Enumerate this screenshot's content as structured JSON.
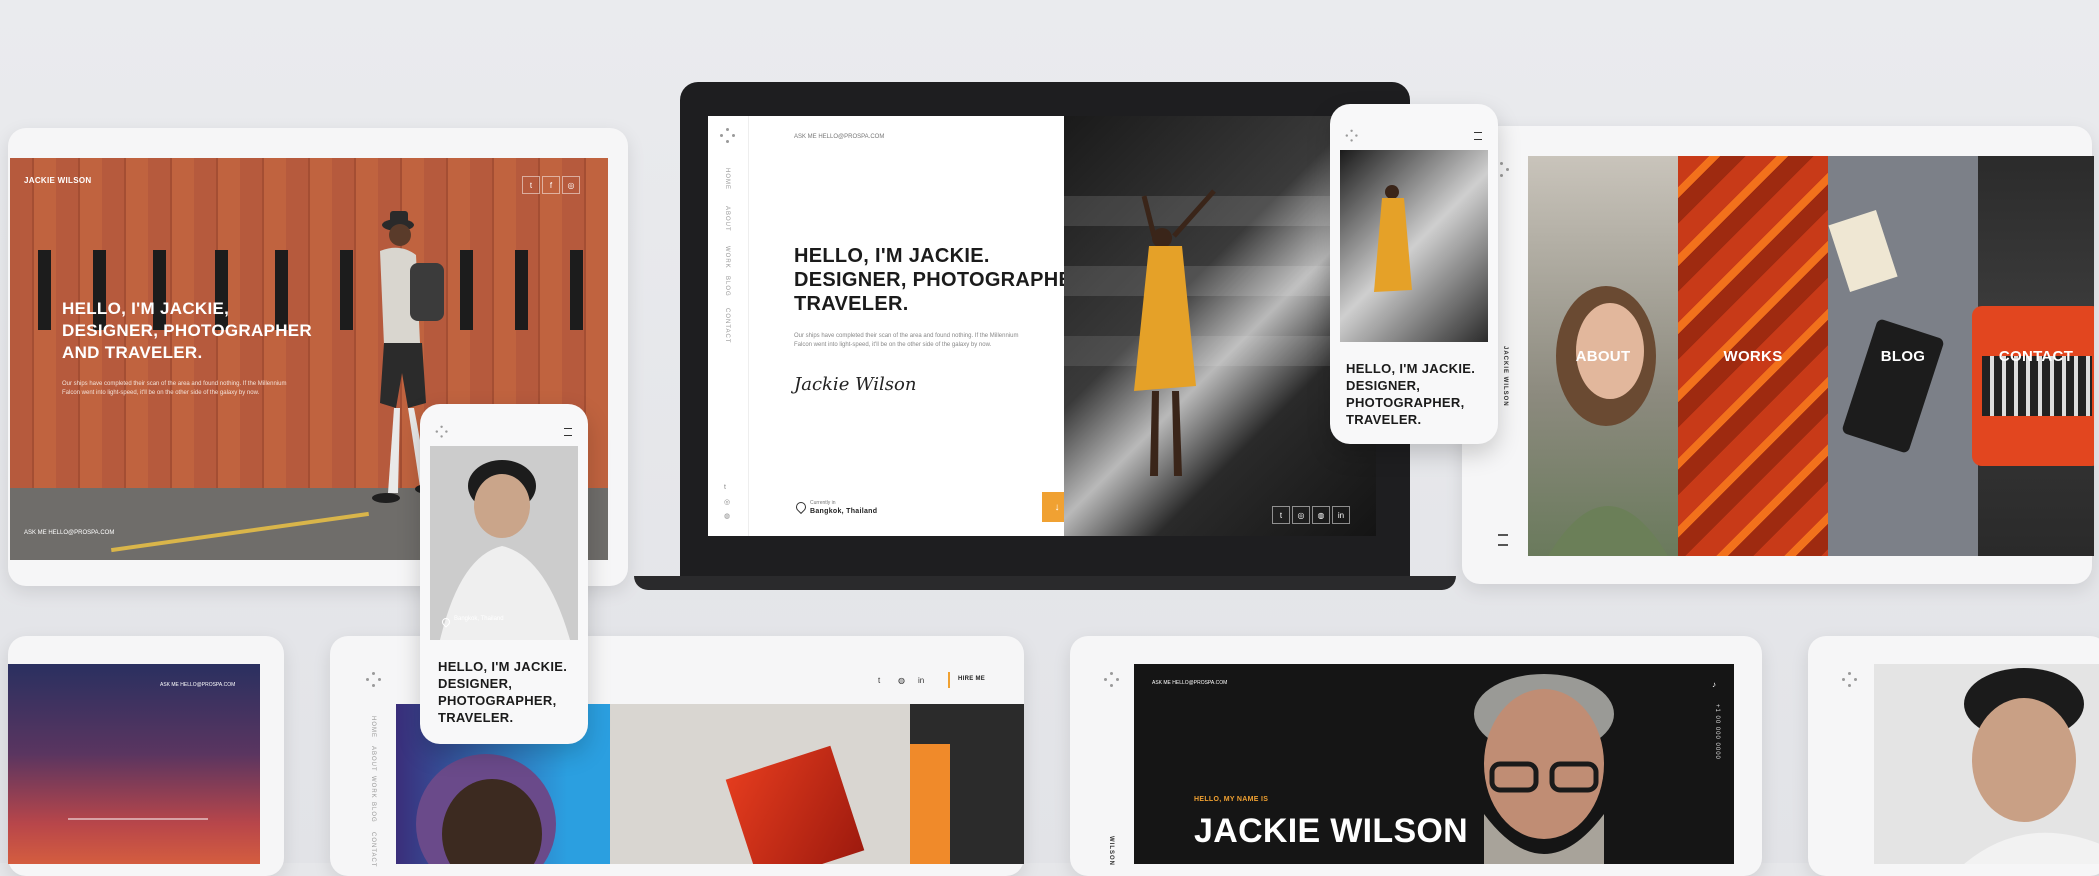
{
  "tablet_left": {
    "brand": "JACKIE WILSON",
    "headline_lines": [
      "HELLO, I'M JACKIE,",
      "DESIGNER, PHOTOGRAPHER",
      "AND TRAVELER."
    ],
    "paragraph": "Our ships have completed their scan of the area and found nothing. If the Millennium Falcon went into light-speed, it'll be on the other side of the galaxy by now.",
    "footer": "ASK ME   HELLO@PROSPA.COM",
    "social": [
      "t",
      "f",
      "◎"
    ]
  },
  "laptop": {
    "top_link": "ASK ME   HELLO@PROSPA.COM",
    "nav": [
      "HOME",
      "ABOUT",
      "WORK",
      "BLOG",
      "CONTACT"
    ],
    "headline_lines": [
      "HELLO, I'M JACKIE.",
      "DESIGNER, PHOTOGRAPHER,",
      "TRAVELER."
    ],
    "paragraph": "Our ships have completed their scan of the area and found nothing. If the Millennium Falcon went into light-speed, it'll be on the other side of the galaxy by now.",
    "signature": "Jackie Wilson",
    "location_label": "Currently in",
    "location": "Bangkok, Thailand",
    "arrow": "↓",
    "social": [
      "t",
      "◎",
      "◍",
      "in"
    ]
  },
  "phone_right": {
    "headline_lines": [
      "HELLO, I'M JACKIE.",
      "DESIGNER,",
      "PHOTOGRAPHER,",
      "TRAVELER."
    ]
  },
  "phone_left": {
    "location": "Bangkok, Thailand",
    "headline_lines": [
      "HELLO, I'M JACKIE.",
      "DESIGNER,",
      "PHOTOGRAPHER,",
      "TRAVELER."
    ]
  },
  "tablet_right": {
    "brand_vertical": "JACKIE WILSON",
    "panels": [
      "ABOUT",
      "WORKS",
      "BLOG",
      "CONTACT"
    ]
  },
  "tablet_bottom_left": {
    "top_link": "ASK ME   HELLO@PROSPA.COM"
  },
  "tablet_bottom_mid": {
    "nav": [
      "HOME",
      "ABOUT",
      "WORK",
      "BLOG",
      "CONTACT"
    ],
    "hire": "HIRE ME",
    "social": [
      "t",
      "◍",
      "in"
    ]
  },
  "tablet_bottom_right": {
    "top_link": "ASK ME   HELLO@PROSPA.COM",
    "intro": "HELLO, MY NAME IS",
    "name": "JACKIE WILSON",
    "phone": "+1 00 000 0000",
    "brand_vertical": "WILSON"
  },
  "colors": {
    "accent": "#f0a132",
    "dark": "#1f1f22",
    "background": "#e6e7ea"
  }
}
